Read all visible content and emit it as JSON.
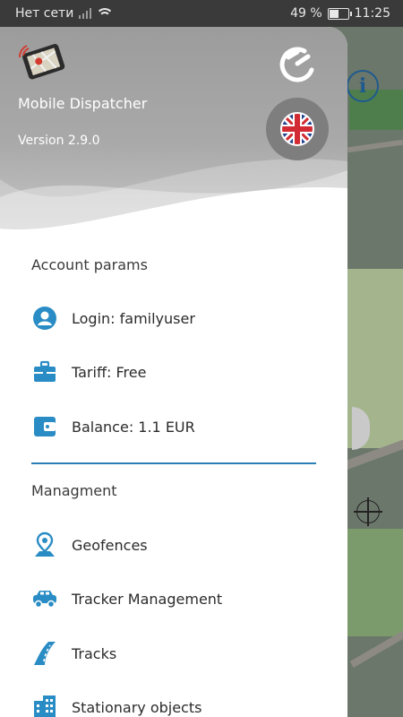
{
  "status_bar": {
    "carrier": "Нет сети",
    "battery_text": "49 %",
    "battery_level": 49,
    "time": "11:25"
  },
  "drawer": {
    "app_name": "Mobile Dispatcher",
    "version": "Version 2.9.0",
    "language_flag": "uk-flag-icon",
    "sections": {
      "account": {
        "title": "Account params",
        "items": [
          {
            "label": "Login: familyuser",
            "icon": "user-icon"
          },
          {
            "label": "Tariff: Free",
            "icon": "briefcase-icon"
          },
          {
            "label": "Balance: 1.1 EUR",
            "icon": "wallet-icon"
          }
        ]
      },
      "management": {
        "title": "Managment",
        "items": [
          {
            "label": "Geofences",
            "icon": "geofence-pin-icon"
          },
          {
            "label": "Tracker Management",
            "icon": "car-icon"
          },
          {
            "label": "Tracks",
            "icon": "road-icon"
          },
          {
            "label": "Stationary objects",
            "icon": "building-icon"
          }
        ]
      }
    }
  },
  "map": {
    "info_glyph": "i"
  },
  "colors": {
    "accent": "#2a7fb4",
    "icon": "#2a8cc4",
    "status_bar": "#3a3a3a"
  }
}
